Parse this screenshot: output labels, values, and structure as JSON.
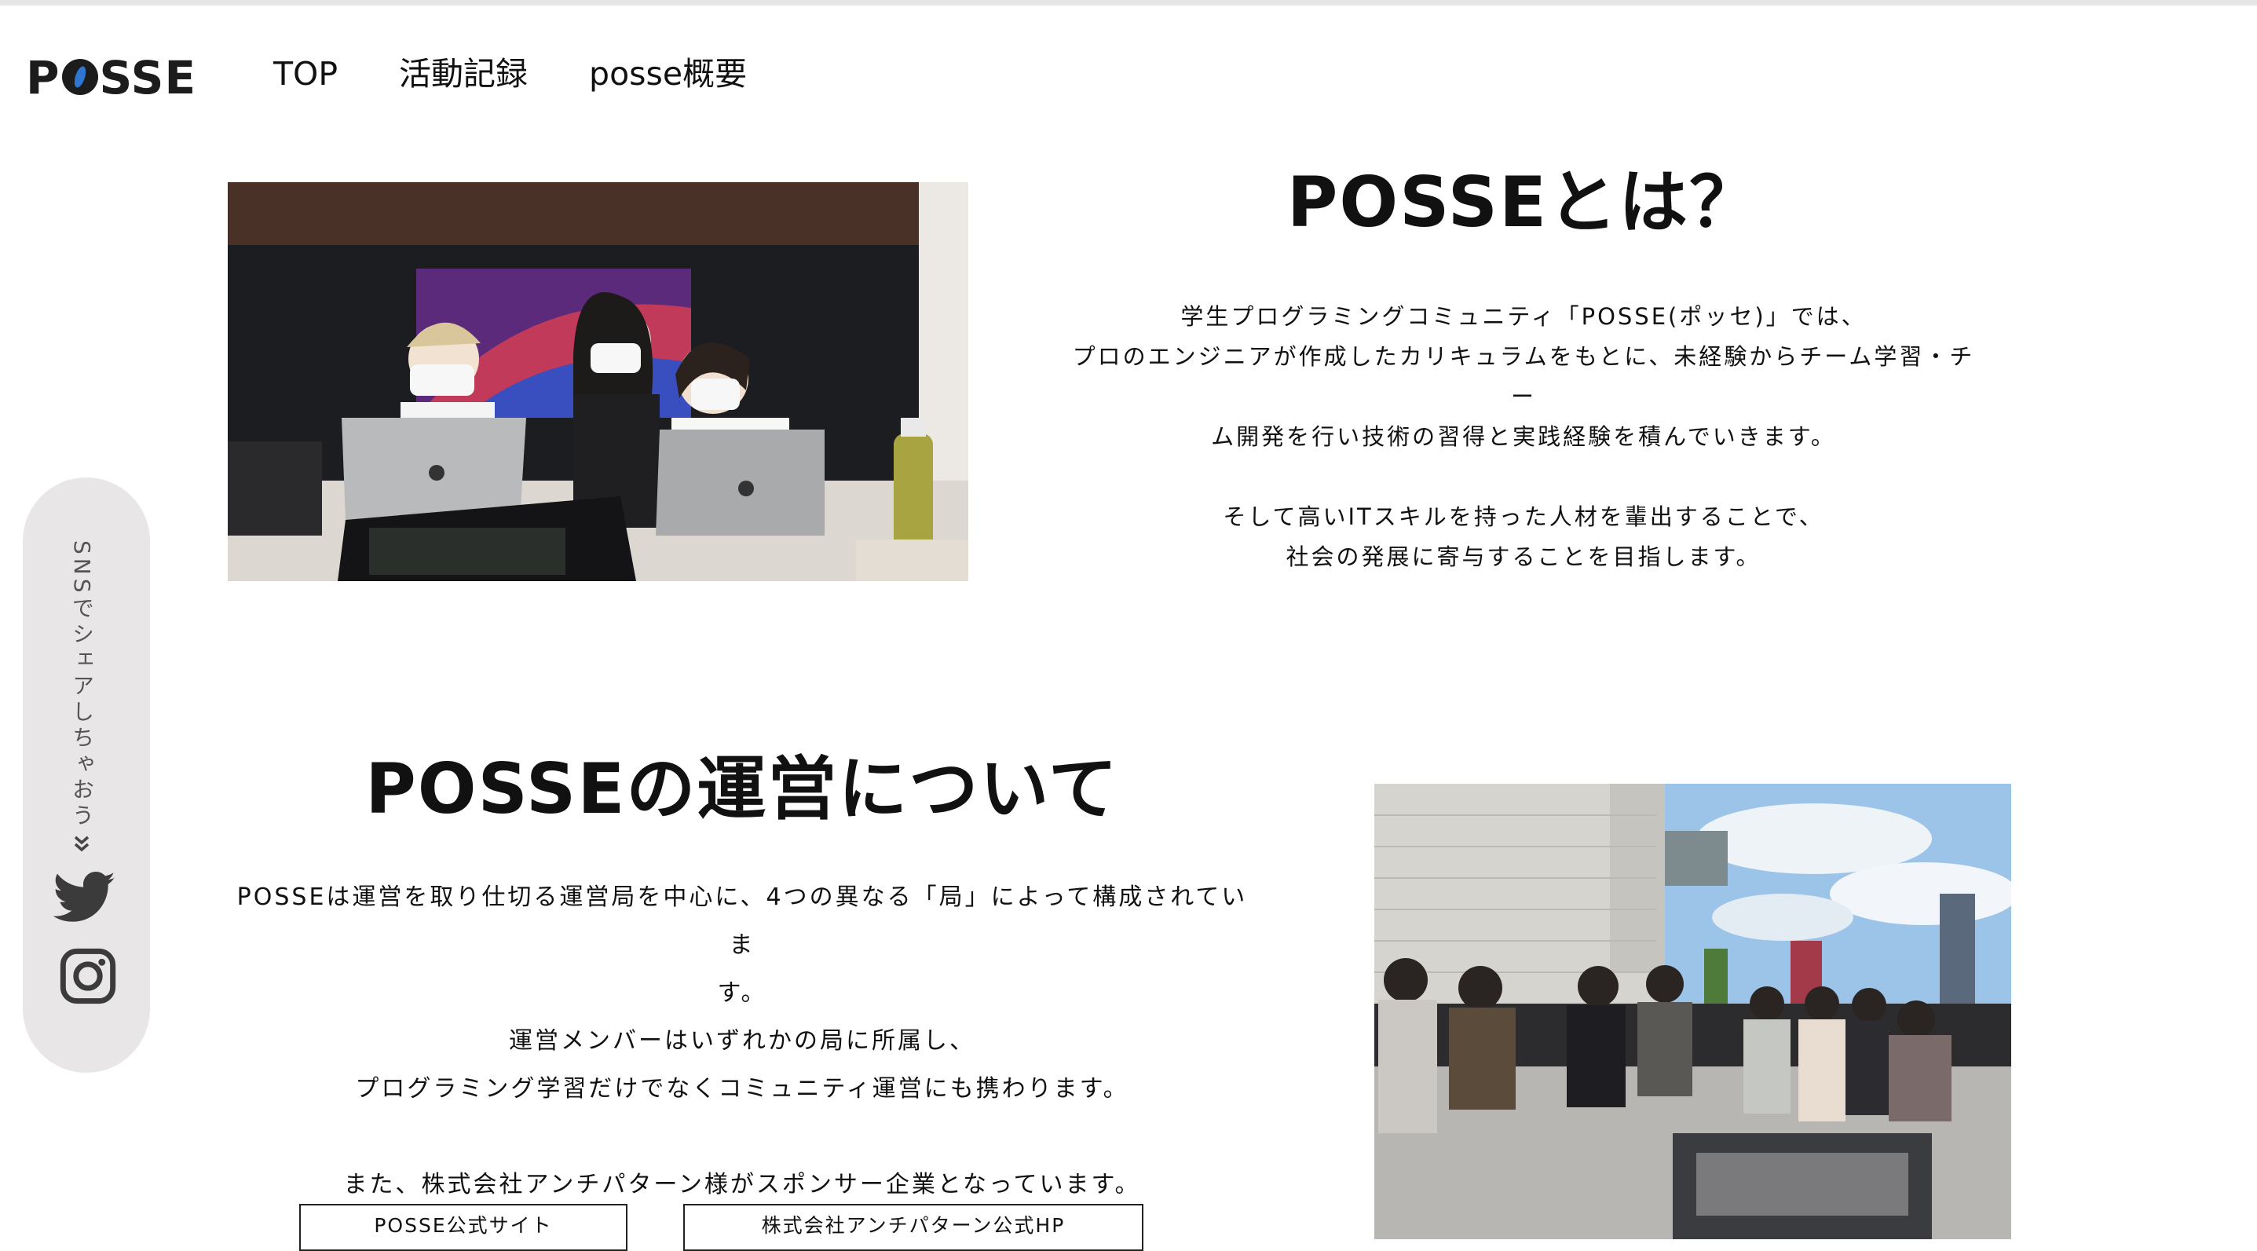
{
  "header": {
    "logo_text": "POSSE",
    "nav": [
      "TOP",
      "活動記録",
      "posse概要"
    ]
  },
  "sidebar": {
    "share_label": "SNSでシェアしちゃおう",
    "icons": [
      "chevron-double-down-icon",
      "twitter-icon",
      "instagram-icon"
    ]
  },
  "about": {
    "title": "POSSEとは？",
    "lines": [
      "学生プログラミングコミュニティ「POSSE(ポッセ)」では、",
      "プロのエンジニアが作成したカリキュラムをもとに、未経験からチーム学習・チー",
      "ム開発を行い技術の習得と実践経験を積んでいきます。",
      "",
      "そして高いITスキルを持った人材を輩出することで、",
      "社会の発展に寄与することを目指します。"
    ]
  },
  "operation": {
    "title": "POSSEの運営について",
    "lines": [
      "POSSEは運営を取り仕切る運営局を中心に、4つの異なる「局」によって構成されていま",
      "す。",
      "運営メンバーはいずれかの局に所属し、",
      "プログラミング学習だけでなくコミュニティ運営にも携わります。",
      "",
      "また、株式会社アンチパターン様がスポンサー企業となっています。"
    ],
    "buttons": [
      "POSSE公式サイト",
      "株式会社アンチパターン公式HP"
    ]
  },
  "colors": {
    "accent_blue": "#2f76d2",
    "sidebar_bg": "#e8e6e7",
    "text": "#111111"
  }
}
